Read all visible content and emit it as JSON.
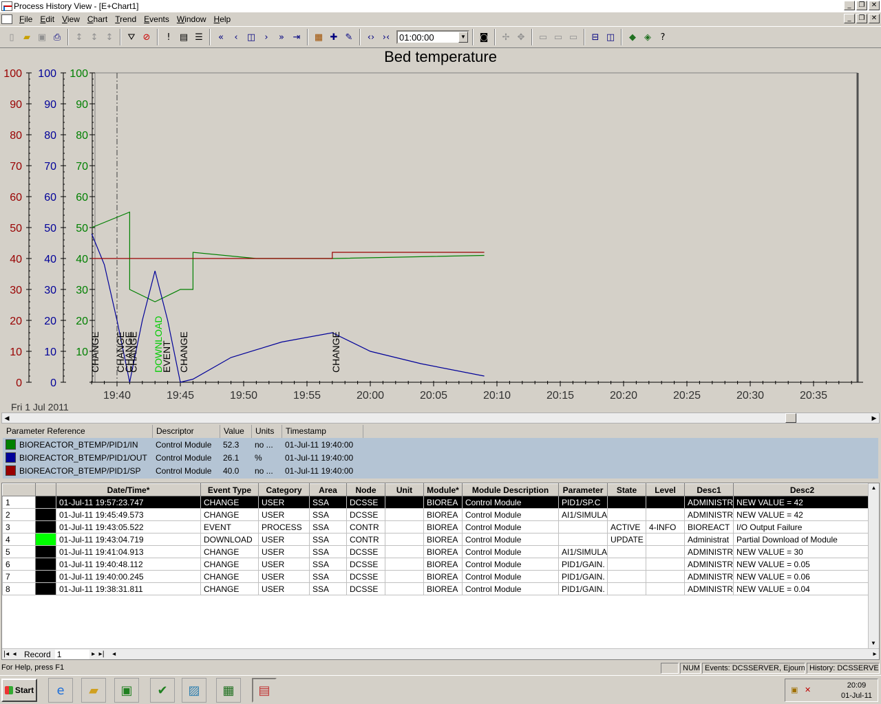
{
  "window": {
    "title": "Process History View - [E+Chart1]",
    "min": "_",
    "restore": "❐",
    "close": "✕"
  },
  "menu": [
    {
      "key": "F",
      "rest": "ile"
    },
    {
      "key": "E",
      "rest": "dit"
    },
    {
      "key": "V",
      "rest": "iew"
    },
    {
      "key": "C",
      "rest": "hart"
    },
    {
      "key": "T",
      "rest": "rend"
    },
    {
      "key": "E",
      "rest": "vents"
    },
    {
      "key": "W",
      "rest": "indow"
    },
    {
      "key": "H",
      "rest": "elp"
    }
  ],
  "toolbar": {
    "time_span": "01:00:00"
  },
  "chart": {
    "title": "Bed temperature",
    "date_label": "Fri 1 Jul 2011",
    "colors": {
      "in": "#008000",
      "out": "#000099",
      "sp": "#990000",
      "plot_bg": "#d4d0c8"
    }
  },
  "chart_data": {
    "type": "line",
    "title": "Bed temperature",
    "x_ticks": [
      "19:40",
      "19:45",
      "19:50",
      "19:55",
      "20:00",
      "20:05",
      "20:10",
      "20:15",
      "20:20",
      "20:25",
      "20:30",
      "20:35"
    ],
    "xlim_minutes_after_1938": [
      0,
      60
    ],
    "y_axes": [
      {
        "color": "#990000",
        "ylim": [
          0,
          100
        ],
        "ticks": [
          0,
          10,
          20,
          30,
          40,
          50,
          60,
          70,
          80,
          90,
          100
        ]
      },
      {
        "color": "#000099",
        "ylim": [
          0,
          100
        ],
        "ticks": [
          0,
          10,
          20,
          30,
          40,
          50,
          60,
          70,
          80,
          90,
          100
        ]
      },
      {
        "color": "#008000",
        "ylim": [
          0,
          100
        ],
        "ticks": [
          10,
          20,
          30,
          40,
          50,
          60,
          70,
          80,
          90,
          100
        ]
      }
    ],
    "series": [
      {
        "name": "BIOREACTOR_BTEMP/PID1/IN",
        "color": "#008000",
        "points": [
          [
            "19:38",
            50
          ],
          [
            "19:41",
            55
          ],
          [
            "19:41",
            30
          ],
          [
            "19:43",
            26
          ],
          [
            "19:45",
            30
          ],
          [
            "19:46",
            30
          ],
          [
            "19:46",
            42
          ],
          [
            "19:51",
            40
          ],
          [
            "19:55",
            40
          ],
          [
            "19:57",
            40
          ],
          [
            "20:09",
            41
          ]
        ]
      },
      {
        "name": "BIOREACTOR_BTEMP/PID1/OUT",
        "color": "#000099",
        "points": [
          [
            "19:38",
            48
          ],
          [
            "19:39",
            38
          ],
          [
            "19:40",
            20
          ],
          [
            "19:41",
            0
          ],
          [
            "19:42",
            20
          ],
          [
            "19:43",
            36
          ],
          [
            "19:44",
            20
          ],
          [
            "19:45",
            0
          ],
          [
            "19:46",
            1
          ],
          [
            "19:49",
            8
          ],
          [
            "19:53",
            13
          ],
          [
            "19:57",
            16
          ],
          [
            "20:00",
            10
          ],
          [
            "20:04",
            6
          ],
          [
            "20:09",
            2
          ]
        ]
      },
      {
        "name": "BIOREACTOR_BTEMP/PID1/SP",
        "color": "#990000",
        "points": [
          [
            "19:38",
            40
          ],
          [
            "19:57",
            40
          ],
          [
            "19:57",
            42
          ],
          [
            "20:09",
            42
          ]
        ]
      }
    ],
    "event_markers": [
      {
        "time": "19:38",
        "label": "CHANGE",
        "color": "#000000"
      },
      {
        "time": "19:40",
        "label": "CHANGE",
        "color": "#000000"
      },
      {
        "time": "19:40",
        "label": "CHANGE",
        "color": "#000000"
      },
      {
        "time": "19:41",
        "label": "CHANGE",
        "color": "#000000"
      },
      {
        "time": "19:43",
        "label": "DOWNLOAD",
        "color": "#00cc00"
      },
      {
        "time": "19:43",
        "label": "EVENT",
        "color": "#000000"
      },
      {
        "time": "19:45",
        "label": "CHANGE",
        "color": "#000000"
      },
      {
        "time": "19:57",
        "label": "CHANGE",
        "color": "#000000"
      }
    ]
  },
  "legend": {
    "headers": [
      "Parameter Reference",
      "Descriptor",
      "Value",
      "Units",
      "Timestamp"
    ],
    "rows": [
      {
        "color": "#008000",
        "ref": "BIOREACTOR_BTEMP/PID1/IN",
        "desc": "Control Module",
        "value": "52.3",
        "units": "no ...",
        "ts": "01-Jul-11 19:40:00"
      },
      {
        "color": "#000099",
        "ref": "BIOREACTOR_BTEMP/PID1/OUT",
        "desc": "Control Module",
        "value": "26.1",
        "units": "%",
        "ts": "01-Jul-11 19:40:00"
      },
      {
        "color": "#990000",
        "ref": "BIOREACTOR_BTEMP/PID1/SP",
        "desc": "Control Module",
        "value": "40.0",
        "units": "no ...",
        "ts": "01-Jul-11 19:40:00"
      }
    ]
  },
  "events": {
    "headers": [
      "",
      "",
      "Date/Time*",
      "Event Type",
      "Category",
      "Area",
      "Node",
      "Unit",
      "Module*",
      "Module Description",
      "Parameter",
      "State",
      "Level",
      "Desc1",
      "Desc2"
    ],
    "rows": [
      {
        "n": "1",
        "ind": "#000000",
        "dt": "01-Jul-11 19:57:23.747",
        "type": "CHANGE",
        "cat": "USER",
        "area": "SSA",
        "node": "DCSSE",
        "unit": "",
        "mod": "BIOREA",
        "mdesc": "Control Module",
        "param": "PID1/SP.C",
        "state": "",
        "level": "",
        "d1": "ADMINISTR",
        "d2": "NEW VALUE = 42"
      },
      {
        "n": "2",
        "ind": "#000000",
        "dt": "01-Jul-11 19:45:49.573",
        "type": "CHANGE",
        "cat": "USER",
        "area": "SSA",
        "node": "DCSSE",
        "unit": "",
        "mod": "BIOREA",
        "mdesc": "Control Module",
        "param": "AI1/SIMULA",
        "state": "",
        "level": "",
        "d1": "ADMINISTR",
        "d2": "NEW VALUE = 42"
      },
      {
        "n": "3",
        "ind": "#000000",
        "dt": "01-Jul-11 19:43:05.522",
        "type": "EVENT",
        "cat": "PROCESS",
        "area": "SSA",
        "node": "CONTR",
        "unit": "",
        "mod": "BIOREA",
        "mdesc": "Control Module",
        "param": "",
        "state": "ACTIVE",
        "level": "4-INFO",
        "d1": "BIOREACT",
        "d2": "I/O Output Failure"
      },
      {
        "n": "4",
        "ind": "#00ff00",
        "dt": "01-Jul-11 19:43:04.719",
        "type": "DOWNLOAD",
        "cat": "USER",
        "area": "SSA",
        "node": "CONTR",
        "unit": "",
        "mod": "BIOREA",
        "mdesc": "Control Module",
        "param": "",
        "state": "UPDATE",
        "level": "",
        "d1": "Administrat",
        "d2": "Partial Download of Module"
      },
      {
        "n": "5",
        "ind": "#000000",
        "dt": "01-Jul-11 19:41:04.913",
        "type": "CHANGE",
        "cat": "USER",
        "area": "SSA",
        "node": "DCSSE",
        "unit": "",
        "mod": "BIOREA",
        "mdesc": "Control Module",
        "param": "AI1/SIMULA",
        "state": "",
        "level": "",
        "d1": "ADMINISTR",
        "d2": "NEW VALUE = 30"
      },
      {
        "n": "6",
        "ind": "#000000",
        "dt": "01-Jul-11 19:40:48.112",
        "type": "CHANGE",
        "cat": "USER",
        "area": "SSA",
        "node": "DCSSE",
        "unit": "",
        "mod": "BIOREA",
        "mdesc": "Control Module",
        "param": "PID1/GAIN.",
        "state": "",
        "level": "",
        "d1": "ADMINISTR",
        "d2": "NEW VALUE = 0.05"
      },
      {
        "n": "7",
        "ind": "#000000",
        "dt": "01-Jul-11 19:40:00.245",
        "type": "CHANGE",
        "cat": "USER",
        "area": "SSA",
        "node": "DCSSE",
        "unit": "",
        "mod": "BIOREA",
        "mdesc": "Control Module",
        "param": "PID1/GAIN.",
        "state": "",
        "level": "",
        "d1": "ADMINISTR",
        "d2": "NEW VALUE = 0.06"
      },
      {
        "n": "8",
        "ind": "#000000",
        "dt": "01-Jul-11 19:38:31.811",
        "type": "CHANGE",
        "cat": "USER",
        "area": "SSA",
        "node": "DCSSE",
        "unit": "",
        "mod": "BIOREA",
        "mdesc": "Control Module",
        "param": "PID1/GAIN.",
        "state": "",
        "level": "",
        "d1": "ADMINISTR",
        "d2": "NEW VALUE = 0.04"
      }
    ],
    "record_label": "Record",
    "record_value": "1"
  },
  "status": {
    "help": "For Help, press F1",
    "num": "NUM",
    "events": "Events: DCSSERVER, Ejournal",
    "history": "History: DCSSERVER"
  },
  "taskbar": {
    "start": "Start",
    "time": "20:09",
    "date": "01-Jul-11"
  }
}
